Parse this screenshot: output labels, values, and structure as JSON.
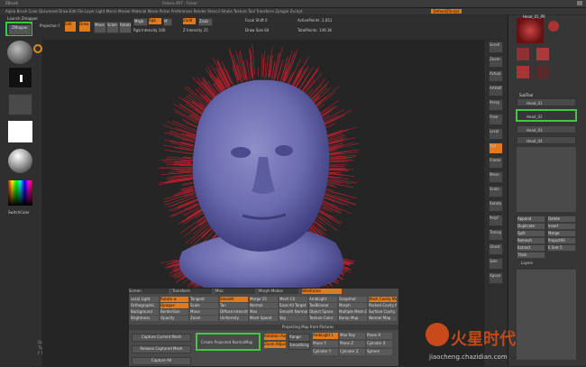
{
  "title_bar": {
    "app": "ZBrush",
    "center": "Fedora 4R7 · Fraser"
  },
  "top_menu": {
    "items": [
      "Alpha",
      "Brush",
      "Color",
      "Document",
      "Draw",
      "Edit",
      "File",
      "Layer",
      "Light",
      "Macro",
      "Marker",
      "Material",
      "Movie",
      "Picker",
      "Preferences",
      "Render",
      "Stencil",
      "Stroke",
      "Texture",
      "Tool",
      "Transform",
      "Zplugin",
      "Zscript"
    ],
    "right_button": "DefaultZScript"
  },
  "top_panel": {
    "launch_label": "Launch Zmapper",
    "zmapper_button": "ZMapper",
    "projection_label": "Projection Master",
    "edit_label": "Edit",
    "draw_label": "Draw",
    "move_label": "Move",
    "scale_label": "Scale",
    "rotate_label": "Rotate",
    "mrgb_label": "Mrgb",
    "rgb_label": "Rgb",
    "m_label": "M",
    "zadd_label": "Zadd",
    "zsub_label": "Zsub",
    "rgb_intensity": "Rgb Intensity 100",
    "z_intensity": "Z Intensity 25",
    "focal_shift": "Focal Shift 0",
    "draw_size": "Draw Size 64",
    "active_points": "ActivePoints: 2,651",
    "total_points": "TotalPoints: 149.1K"
  },
  "left_shelf": {
    "gradient_label": "SwitchColor",
    "stats": [
      "Quick 1000",
      "Tip A",
      "F P 1 75"
    ]
  },
  "right_shelf": {
    "buttons": [
      "Scroll",
      "Zoom",
      "Actual",
      "AAHalf",
      "Persp",
      "Floor",
      "Local",
      "Xyz",
      "Frame",
      "Move",
      "Scale",
      "Rotate",
      "PolyF",
      "Transp",
      "Ghost",
      "Solo",
      "Xpose"
    ]
  },
  "right_panel": {
    "tool_title": "Head_01_PR",
    "subtool_header": "SubTool",
    "item1": "Head_01",
    "item2": "Head_02",
    "item3": "Head_03",
    "item4": "Head_04",
    "btns": [
      "Append",
      "Delete",
      "Duplicate",
      "Insert",
      "Split",
      "Merge",
      "Remesh",
      "ProjectAll",
      "Extract",
      "E Smt 5",
      "Thick"
    ],
    "bottom_label": "Layers"
  },
  "zmapper": {
    "tabs": [
      "Screen",
      "Transform",
      "Misc",
      "Morph Modes",
      "Wireframe",
      "Normal & Cavity Map",
      "Expert Pass 1",
      "Expert Pass 2",
      "Misc"
    ],
    "rows": [
      [
        "Local Light",
        "Rotate ⊕",
        "Tangent",
        "Smooth",
        "Merge 15",
        "Mesh Ctl",
        "AmbLight",
        "Snapshot",
        "Mesh Cavity Map"
      ],
      [
        "Orthographic",
        "Opaque",
        "Scale",
        "Tan",
        "Normal",
        "Ease All Target",
        "TexBilinear",
        "Morph",
        "Packed Cavity Map"
      ],
      [
        "Background",
        "BorderSize",
        "Move",
        "Diffuse Intensity",
        "Max",
        "Smooth Normals",
        "Object Space",
        "Multiple Mesh Data",
        "Surface Cavity Map"
      ],
      [
        "Brightness",
        "Opacity",
        "Zoom",
        "Uniformity",
        "Mesh Speed",
        "Sky",
        "Texture Color",
        "Bump Map",
        "Normal Map"
      ]
    ],
    "bottom_buttons": [
      "Capture Current Mesh",
      "Capture All",
      "Create Projected NormalMap",
      "Release Captured Mesh",
      "Rotation Angle",
      "Zoom Adjust",
      "Range",
      "Smoothing"
    ],
    "footer_bar": "Projecting Map from Pictures",
    "right_labels": [
      "AmbLight 1",
      "Max Ray",
      "Plane X",
      "Plane Y",
      "Plane Z",
      "Cylinder X",
      "Cylinder Y",
      "Cylinder Z",
      "Sphere"
    ]
  },
  "watermark": {
    "brand": "火星时代",
    "url": "jiaocheng.chazidian.com"
  }
}
